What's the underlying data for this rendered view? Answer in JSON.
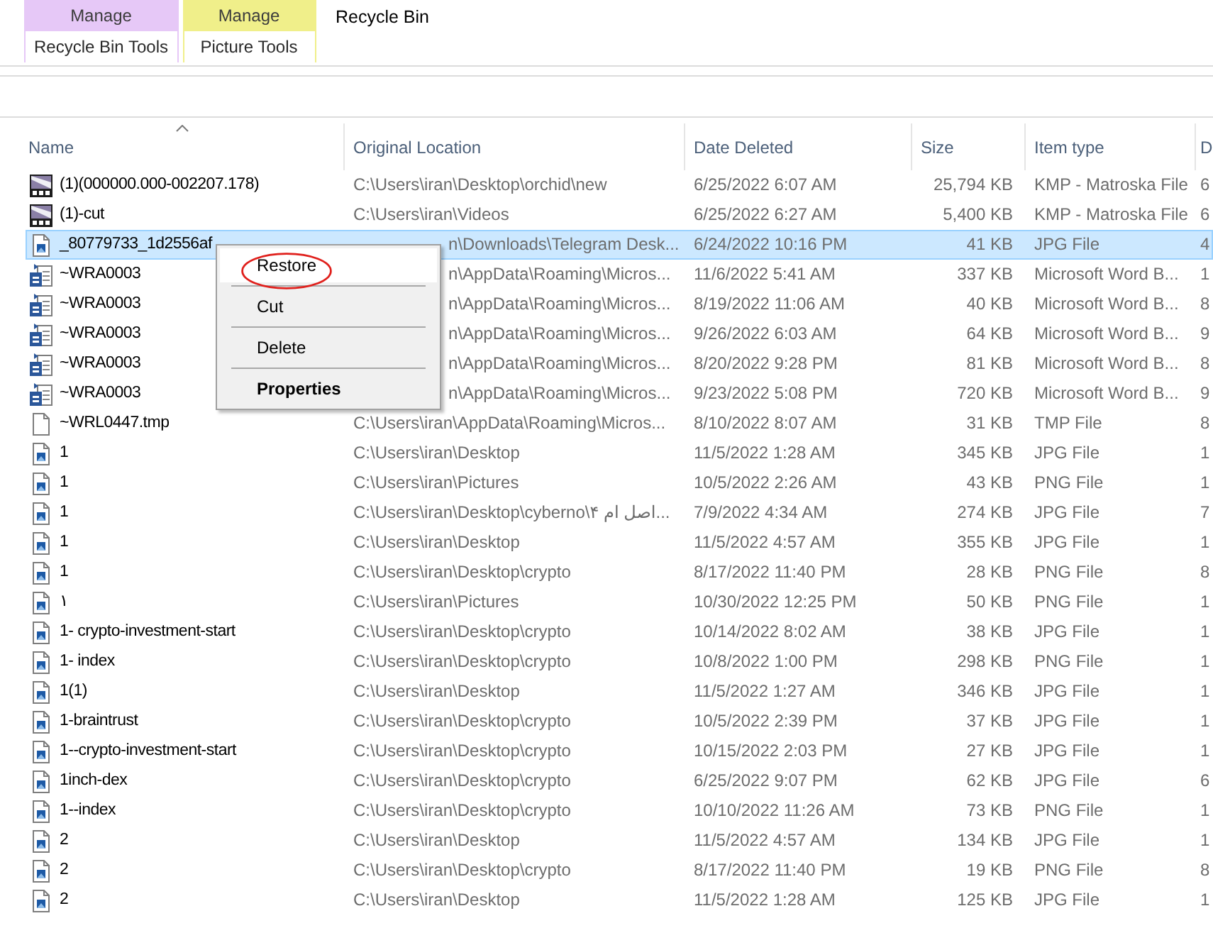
{
  "contextual_tabs": [
    {
      "tab": "Manage",
      "group": "Recycle Bin Tools",
      "color": "#e6c8f7"
    },
    {
      "tab": "Manage",
      "group": "Picture Tools",
      "color": "#f0ef8a"
    }
  ],
  "window": {
    "title": "Recycle Bin"
  },
  "table": {
    "columns": [
      {
        "label": "Name",
        "sorted": true
      },
      {
        "label": "Original Location",
        "sorted": false
      },
      {
        "label": "Date Deleted",
        "sorted": false
      },
      {
        "label": "Size",
        "sorted": false
      },
      {
        "label": "Item type",
        "sorted": false
      },
      {
        "label": "D",
        "sorted": false
      }
    ],
    "rows": [
      {
        "kind": "video",
        "name": "(1)(000000.000-002207.178)",
        "original_location": "C:\\Users\\iran\\Desktop\\orchid\\new",
        "date_deleted": "6/25/2022 6:07 AM",
        "size": "25,794 KB",
        "item_type": "KMP - Matroska File",
        "column_6": "6",
        "selected": false,
        "location_covered": false
      },
      {
        "kind": "video",
        "name": "(1)-cut",
        "original_location": "C:\\Users\\iran\\Videos",
        "date_deleted": "6/25/2022 6:27 AM",
        "size": "5,400 KB",
        "item_type": "KMP - Matroska File",
        "column_6": "6",
        "selected": false,
        "location_covered": false
      },
      {
        "kind": "image",
        "name": "_80779733_1d2556af",
        "original_location": "n\\Downloads\\Telegram Desk...",
        "date_deleted": "6/24/2022 10:16 PM",
        "size": "41 KB",
        "item_type": "JPG File",
        "column_6": "4",
        "selected": true,
        "location_covered": true
      },
      {
        "kind": "word",
        "name": "~WRA0003",
        "original_location": "n\\AppData\\Roaming\\Micros...",
        "date_deleted": "11/6/2022 5:41 AM",
        "size": "337 KB",
        "item_type": "Microsoft Word B...",
        "column_6": "1",
        "selected": false,
        "location_covered": true
      },
      {
        "kind": "word",
        "name": "~WRA0003",
        "original_location": "n\\AppData\\Roaming\\Micros...",
        "date_deleted": "8/19/2022 11:06 AM",
        "size": "40 KB",
        "item_type": "Microsoft Word B...",
        "column_6": "8",
        "selected": false,
        "location_covered": true
      },
      {
        "kind": "word",
        "name": "~WRA0003",
        "original_location": "n\\AppData\\Roaming\\Micros...",
        "date_deleted": "9/26/2022 6:03 AM",
        "size": "64 KB",
        "item_type": "Microsoft Word B...",
        "column_6": "9",
        "selected": false,
        "location_covered": true
      },
      {
        "kind": "word",
        "name": "~WRA0003",
        "original_location": "n\\AppData\\Roaming\\Micros...",
        "date_deleted": "8/20/2022 9:28 PM",
        "size": "81 KB",
        "item_type": "Microsoft Word B...",
        "column_6": "8",
        "selected": false,
        "location_covered": true
      },
      {
        "kind": "word",
        "name": "~WRA0003",
        "original_location": "n\\AppData\\Roaming\\Micros...",
        "date_deleted": "9/23/2022 5:08 PM",
        "size": "720 KB",
        "item_type": "Microsoft Word B...",
        "column_6": "9",
        "selected": false,
        "location_covered": true
      },
      {
        "kind": "blank",
        "name": "~WRL0447.tmp",
        "original_location": "C:\\Users\\iran\\AppData\\Roaming\\Micros...",
        "date_deleted": "8/10/2022 8:07 AM",
        "size": "31 KB",
        "item_type": "TMP File",
        "column_6": "8",
        "selected": false,
        "location_covered": false
      },
      {
        "kind": "image",
        "name": "1",
        "original_location": "C:\\Users\\iran\\Desktop",
        "date_deleted": "11/5/2022 1:28 AM",
        "size": "345 KB",
        "item_type": "JPG File",
        "column_6": "1",
        "selected": false,
        "location_covered": false
      },
      {
        "kind": "image",
        "name": "1",
        "original_location": "C:\\Users\\iran\\Pictures",
        "date_deleted": "10/5/2022 2:26 AM",
        "size": "43 KB",
        "item_type": "PNG File",
        "column_6": "1",
        "selected": false,
        "location_covered": false
      },
      {
        "kind": "image",
        "name": "1",
        "original_location": "C:\\Users\\iran\\Desktop\\cyberno\\۴ اصل ام...",
        "date_deleted": "7/9/2022 4:34 AM",
        "size": "274 KB",
        "item_type": "JPG File",
        "column_6": "7",
        "selected": false,
        "location_covered": false
      },
      {
        "kind": "image",
        "name": "1",
        "original_location": "C:\\Users\\iran\\Desktop",
        "date_deleted": "11/5/2022 4:57 AM",
        "size": "355 KB",
        "item_type": "JPG File",
        "column_6": "1",
        "selected": false,
        "location_covered": false
      },
      {
        "kind": "image",
        "name": "1",
        "original_location": "C:\\Users\\iran\\Desktop\\crypto",
        "date_deleted": "8/17/2022 11:40 PM",
        "size": "28 KB",
        "item_type": "PNG File",
        "column_6": "8",
        "selected": false,
        "location_covered": false
      },
      {
        "kind": "image",
        "name": "۱",
        "original_location": "C:\\Users\\iran\\Pictures",
        "date_deleted": "10/30/2022 12:25 PM",
        "size": "50 KB",
        "item_type": "PNG File",
        "column_6": "1",
        "selected": false,
        "location_covered": false
      },
      {
        "kind": "image",
        "name": "1- crypto-investment-start",
        "original_location": "C:\\Users\\iran\\Desktop\\crypto",
        "date_deleted": "10/14/2022 8:02 AM",
        "size": "38 KB",
        "item_type": "JPG File",
        "column_6": "1",
        "selected": false,
        "location_covered": false
      },
      {
        "kind": "image",
        "name": "1- index",
        "original_location": "C:\\Users\\iran\\Desktop\\crypto",
        "date_deleted": "10/8/2022 1:00 PM",
        "size": "298 KB",
        "item_type": "PNG File",
        "column_6": "1",
        "selected": false,
        "location_covered": false
      },
      {
        "kind": "image",
        "name": "1(1)",
        "original_location": "C:\\Users\\iran\\Desktop",
        "date_deleted": "11/5/2022 1:27 AM",
        "size": "346 KB",
        "item_type": "JPG File",
        "column_6": "1",
        "selected": false,
        "location_covered": false
      },
      {
        "kind": "image",
        "name": "1-braintrust",
        "original_location": "C:\\Users\\iran\\Desktop\\crypto",
        "date_deleted": "10/5/2022 2:39 PM",
        "size": "37 KB",
        "item_type": "JPG File",
        "column_6": "1",
        "selected": false,
        "location_covered": false
      },
      {
        "kind": "image",
        "name": "1--crypto-investment-start",
        "original_location": "C:\\Users\\iran\\Desktop\\crypto",
        "date_deleted": "10/15/2022 2:03 PM",
        "size": "27 KB",
        "item_type": "JPG File",
        "column_6": "1",
        "selected": false,
        "location_covered": false
      },
      {
        "kind": "image",
        "name": "1inch-dex",
        "original_location": "C:\\Users\\iran\\Desktop\\crypto",
        "date_deleted": "6/25/2022 9:07 PM",
        "size": "62 KB",
        "item_type": "JPG File",
        "column_6": "6",
        "selected": false,
        "location_covered": false
      },
      {
        "kind": "image",
        "name": "1--index",
        "original_location": "C:\\Users\\iran\\Desktop\\crypto",
        "date_deleted": "10/10/2022 11:26 AM",
        "size": "73 KB",
        "item_type": "PNG File",
        "column_6": "1",
        "selected": false,
        "location_covered": false
      },
      {
        "kind": "image",
        "name": "2",
        "original_location": "C:\\Users\\iran\\Desktop",
        "date_deleted": "11/5/2022 4:57 AM",
        "size": "134 KB",
        "item_type": "JPG File",
        "column_6": "1",
        "selected": false,
        "location_covered": false
      },
      {
        "kind": "image",
        "name": "2",
        "original_location": "C:\\Users\\iran\\Desktop\\crypto",
        "date_deleted": "8/17/2022 11:40 PM",
        "size": "19 KB",
        "item_type": "PNG File",
        "column_6": "8",
        "selected": false,
        "location_covered": false
      },
      {
        "kind": "image",
        "name": "2",
        "original_location": "C:\\Users\\iran\\Desktop",
        "date_deleted": "11/5/2022 1:28 AM",
        "size": "125 KB",
        "item_type": "JPG File",
        "column_6": "1",
        "selected": false,
        "location_covered": false
      }
    ]
  },
  "context_menu": {
    "items": [
      {
        "label": "Restore",
        "selected": true,
        "default": false,
        "circled": true
      },
      {
        "label": "Cut",
        "selected": false,
        "default": false,
        "circled": false
      },
      {
        "label": "Delete",
        "selected": false,
        "default": false,
        "circled": false
      },
      {
        "label": "Properties",
        "selected": false,
        "default": true,
        "circled": false
      }
    ]
  }
}
